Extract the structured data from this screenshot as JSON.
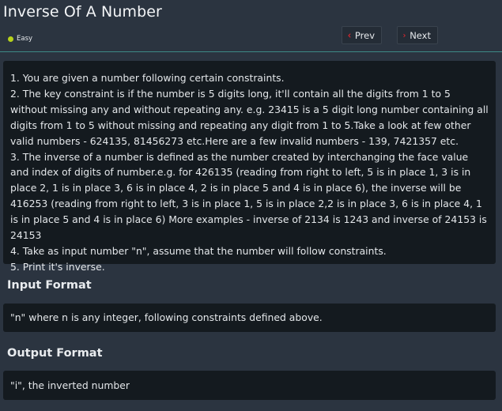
{
  "header": {
    "title": "Inverse Of A Number",
    "difficulty": "Easy",
    "difficulty_color": "#b7d21b",
    "prev_label": "Prev",
    "next_label": "Next",
    "nav_icon_color": "#e0262d",
    "accent_line": "#3d8a86"
  },
  "description": {
    "lines": [
      "1. You are given a number following certain constraints.",
      "2. The key constraint is if the number is 5 digits long, it'll contain all the digits from 1 to 5 without missing any and without repeating any. e.g. 23415 is a 5 digit long number containing all digits from 1 to 5 without missing and repeating any digit from 1 to 5.Take a look at few other valid numbers - 624135, 81456273 etc.Here are a few invalid numbers - 139, 7421357 etc.",
      "3. The inverse of a number is defined as the number created by interchanging the face value and index of digits of number.e.g. for 426135 (reading from right to left, 5 is in place 1, 3 is in place 2, 1 is in place 3, 6 is in place 4, 2 is in place 5 and 4 is in place 6), the inverse will be 416253 (reading from right to left, 3 is in place 1, 5 is in place 2,2 is in place 3, 6 is in place 4, 1 is in place 5 and 4 is in place 6) More examples - inverse of 2134 is 1243 and inverse of 24153 is 24153",
      "4. Take as input number \"n\", assume that the number will follow constraints.",
      "5. Print it's inverse."
    ]
  },
  "input_format": {
    "title": "Input Format",
    "text": "\"n\" where n is any integer, following constraints defined above."
  },
  "output_format": {
    "title": "Output Format",
    "text": "\"i\", the inverted number"
  }
}
